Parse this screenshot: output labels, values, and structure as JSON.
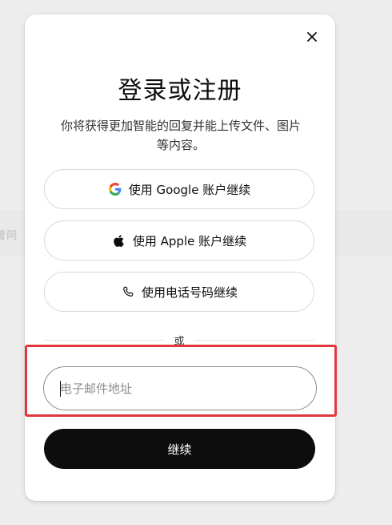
{
  "background": {
    "partial_text": "管问"
  },
  "modal": {
    "close_icon": "close-icon",
    "title": "登录或注册",
    "subtitle": "你将获得更加智能的回复并能上传文件、图片等内容。",
    "buttons": [
      {
        "icon": "google-icon",
        "label": "使用 Google 账户继续"
      },
      {
        "icon": "apple-icon",
        "label": "使用 Apple 账户继续"
      },
      {
        "icon": "phone-icon",
        "label": "使用电话号码继续"
      }
    ],
    "divider_label": "或",
    "email": {
      "placeholder": "电子邮件地址",
      "value": ""
    },
    "continue_label": "继续"
  },
  "colors": {
    "primary_button_bg": "#0d0d0d",
    "highlight_border": "#e0383e",
    "google_blue": "#4285F4",
    "google_red": "#EA4335",
    "google_yellow": "#FBBC05",
    "google_green": "#34A853"
  }
}
